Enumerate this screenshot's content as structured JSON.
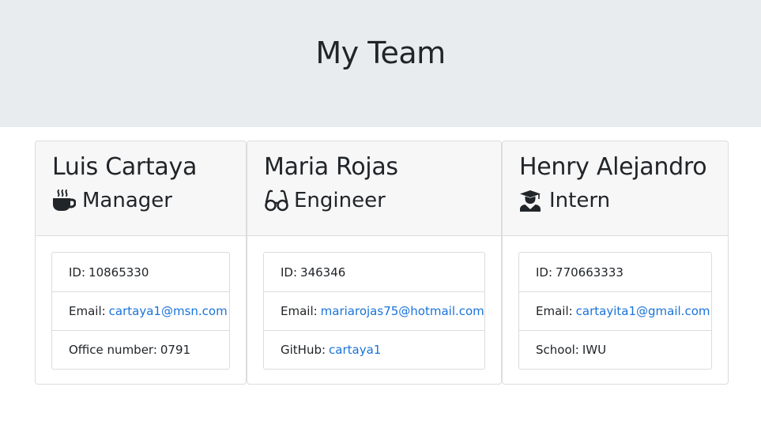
{
  "header": {
    "title": "My Team"
  },
  "cards": [
    {
      "name": "Luis Cartaya",
      "role": "Manager",
      "icon": "coffee-icon",
      "rows": [
        {
          "label": "ID:",
          "value": "10865330"
        },
        {
          "label": "Email:",
          "value": "cartaya1@msn.com"
        },
        {
          "label": "Office number:",
          "value": "0791"
        }
      ]
    },
    {
      "name": "Maria Rojas",
      "role": "Engineer",
      "icon": "glasses-icon",
      "rows": [
        {
          "label": "ID:",
          "value": "346346"
        },
        {
          "label": "Email:",
          "value": "mariarojas75@hotmail.com"
        },
        {
          "label": "GitHub:",
          "value": "cartaya1"
        }
      ]
    },
    {
      "name": "Henry Alejandro",
      "role": "Intern",
      "icon": "graduate-icon",
      "rows": [
        {
          "label": "ID:",
          "value": "770663333"
        },
        {
          "label": "Email:",
          "value": "cartayita1@gmail.com"
        },
        {
          "label": "School:",
          "value": "IWU"
        }
      ]
    }
  ],
  "colors": {
    "header_bg": "#e9ecef",
    "link": "#1a73d9",
    "card_header_bg": "#f7f7f7"
  }
}
